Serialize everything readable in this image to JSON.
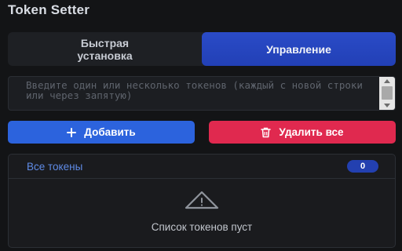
{
  "app": {
    "title": "Token Setter"
  },
  "tabs": [
    {
      "label": "Быстрая установка",
      "active": false
    },
    {
      "label": "Управление",
      "active": true
    }
  ],
  "input": {
    "placeholder": "Введите один или несколько токенов (каждый с новой строки или через запятую)",
    "value": ""
  },
  "actions": {
    "add_label": "Добавить",
    "delete_all_label": "Удалить все"
  },
  "token_list": {
    "title": "Все токены",
    "count": "0",
    "empty_text": "Список токенов пуст"
  },
  "colors": {
    "accent": "#2c63dd",
    "danger": "#e0294f",
    "active_tab": "#2240b6",
    "badge": "#2340b0"
  },
  "icons": {
    "add": "plus-icon",
    "delete": "trash-icon",
    "empty": "warning-triangle-icon"
  }
}
